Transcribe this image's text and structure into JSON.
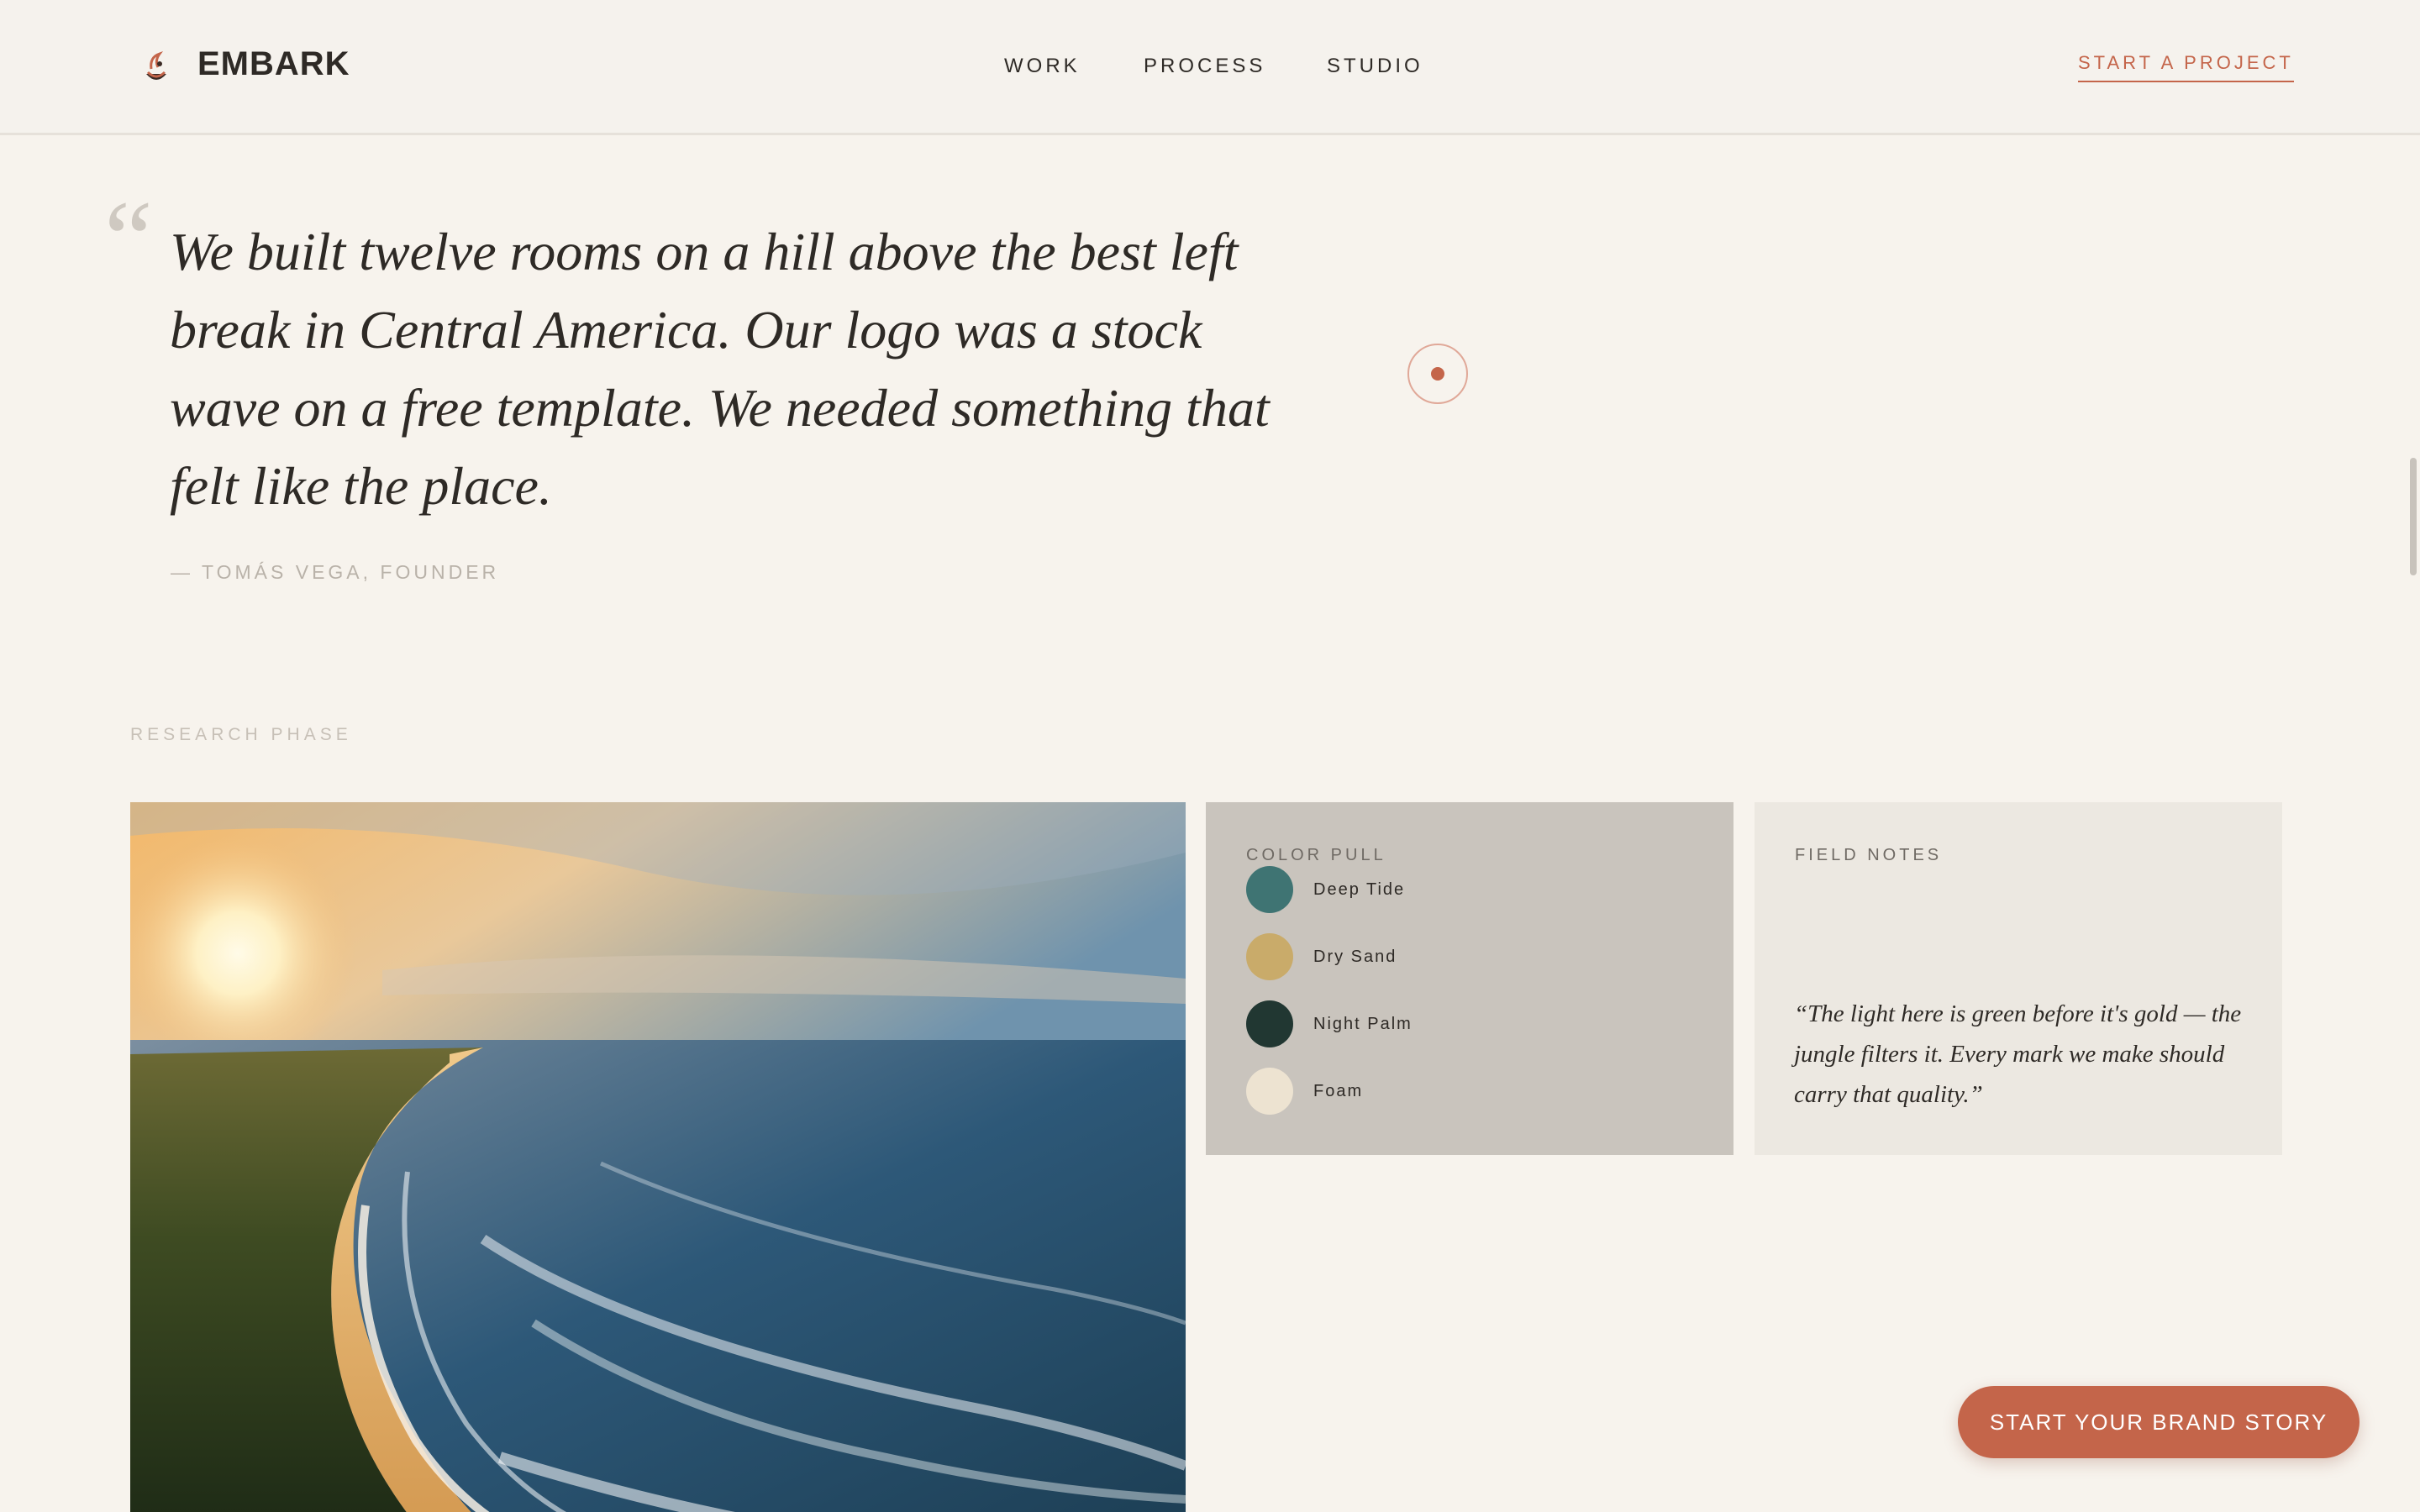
{
  "header": {
    "brand": "EMBARK",
    "logo_icon": "wave-logo-icon",
    "nav": [
      "WORK",
      "PROCESS",
      "STUDIO"
    ],
    "cta": "START A PROJECT"
  },
  "testimonial": {
    "quote": "We built twelve rooms on a hill above the best left break in Central America. Our logo was a stock wave on a free template. We needed something that felt like the place.",
    "attribution": "— TOMÁS VEGA, FOUNDER"
  },
  "research": {
    "section_label": "RESEARCH PHASE",
    "photo_alt_icon": "beach-sunset-photo",
    "color_pull": {
      "label": "COLOR PULL",
      "swatches": [
        {
          "name": "Deep Tide",
          "color": "#3f7473"
        },
        {
          "name": "Dry Sand",
          "color": "#c9ab6a"
        },
        {
          "name": "Night Palm",
          "color": "#213732"
        },
        {
          "name": "Foam",
          "color": "#ede3d1"
        }
      ]
    },
    "field_notes": {
      "label": "FIELD NOTES",
      "text": "“The light here is green before it's gold — the jungle filters it. Every mark we make should carry that quality.”"
    }
  },
  "floating_cta": "START YOUR BRAND STORY",
  "colors": {
    "accent": "#c4654a",
    "background": "#f7f3ed",
    "text": "#2e2a26"
  }
}
